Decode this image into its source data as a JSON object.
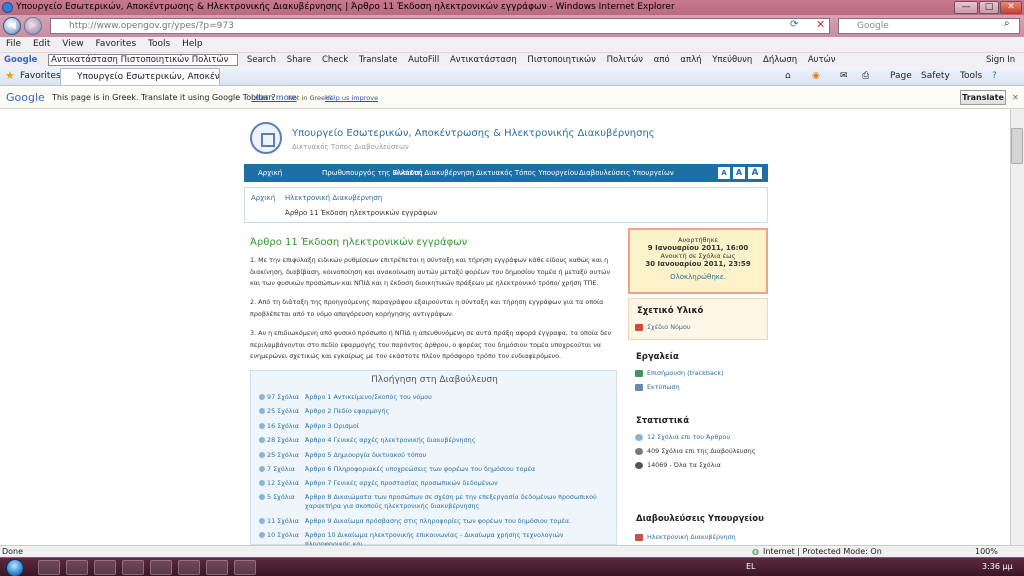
{
  "window": {
    "title": "Υπουργείο Εσωτερικών, Αποκέντρωσης & Ηλεκτρονικής Διακυβέρνησης | Άρθρο 11 Έκδοση ηλεκτρονικών εγγράφων - Windows Internet Explorer",
    "minimize": "—",
    "maximize": "□",
    "close": "✕"
  },
  "address": {
    "url": "http://www.opengov.gr/ypes/?p=973",
    "search_placeholder": "Google"
  },
  "menu": [
    "File",
    "Edit",
    "View",
    "Favorites",
    "Tools",
    "Help"
  ],
  "google_toolbar": {
    "logo": "Google",
    "query": "Αντικατάσταση Πιστοποιητικών Πολιτών",
    "items": [
      "Search",
      "Share",
      "Check",
      "Translate",
      "AutoFill",
      "Αντικατάσταση",
      "Πιστοποιητικών",
      "Πολιτών",
      "από",
      "απλή",
      "Υπεύθυνη",
      "Δήλωση",
      "Αυτών"
    ],
    "sign_in": "Sign In"
  },
  "favorites": {
    "label": "Favorites",
    "tab": "Υπουργείο Εσωτερικών, Αποκέντρω...",
    "page": "Page",
    "safety": "Safety",
    "tools": "Tools"
  },
  "translate_bar": {
    "logo": "Google",
    "message": "This page is in Greek.  Translate it using Google Toolbar?",
    "learn_more": "Learn more",
    "not_greek": "Not in Greek?",
    "help": "Help us improve",
    "button": "Translate",
    "close": "✕"
  },
  "site": {
    "title": "Υπουργείο Εσωτερικών, Αποκέντρωσης & Ηλεκτρονικής Διακυβέρνησης",
    "subtitle": "Δικτυακός Τόπος Διαβουλεύσεων",
    "nav": [
      "Αρχική",
      "Πρωθυπουργός της Ελλάδας",
      "Ανοικτή Διακυβέρνηση",
      "Δικτυακός Τόπος Υπουργείου",
      "Διαβουλεύσεις Υπουργείων"
    ],
    "font_sizes": [
      "A",
      "A",
      "A"
    ]
  },
  "breadcrumb": {
    "home": "Αρχική",
    "section": "Ηλεκτρονική Διακυβέρνηση",
    "current": "Άρθρο 11 Έκδοση ηλεκτρονικών εγγράφων"
  },
  "article": {
    "title": "Άρθρο 11 Έκδοση ηλεκτρονικών εγγράφων",
    "p1": "1.        Με την επιφύλαξη ειδικών ρυθμίσεων επιτρέπεται η σύνταξη και τήρηση εγγράφων κάθε είδους καθώς και η διακίνηση, διαβίβαση, κοινοποίηση  και ανακοίνωση  αυτών μεταξύ φορέων του δημοσίου τομέα  ή μεταξύ αυτών και των φυσικών προσώπων και ΝΠΙΔ και η έκδοση διοικητικών πράξεων με ηλεκτρονικό τρόπο/ χρήση ΤΠΕ.",
    "p2": "2.        Από τη διάταξη της προηγούμενης παραγράφου εξαιρούνται η σύνταξη και τήρηση εγγράφων για τα οποία προβλέπεται από το νόμο απαγόρευση κορήγησης αντιγράφων.",
    "p3": "3.        Αν η επιδιωκόμενη από φυσικό πρόσωπο ή ΝΠΙΔ η απευθυνόμενη σε αυτά πράξη αφορά έγγραφα, τα οποία δεν περιλαμβάνονται στο πεδίο εφαρμογής του παρόντος άρθρου, ο φορέας του δημόσιου τομέα  υποχρεούται να ενημερώνει σχετικώς και εγκαίρως με τον εκάστοτε πλέον πρόσφορο τρόπο τον ενδιαφερόμενο."
  },
  "navigation": {
    "title": "Πλοήγηση στη Διαβούλευση",
    "rows": [
      {
        "count": "97 Σχόλια",
        "title": "Άρθρο 1 Αντικείμενο/Σκοπός του νόμου"
      },
      {
        "count": "25 Σχόλια",
        "title": "Άρθρο 2 Πεδίο εφαρμογής"
      },
      {
        "count": "16 Σχόλια",
        "title": "Άρθρο 3 Ορισμοί"
      },
      {
        "count": "28 Σχόλια",
        "title": "Άρθρο 4 Γενικές αρχές ηλεκτρονικής διακυβέρνησης"
      },
      {
        "count": "25 Σχόλια",
        "title": "Άρθρο 5 Δημιουργία δικτυακού τόπου"
      },
      {
        "count": "7 Σχόλια",
        "title": "Άρθρο 6 Πληροφοριακές υποχρεώσεις των φορέων του δημόσιου τομέα"
      },
      {
        "count": "12 Σχόλια",
        "title": "Άρθρο 7 Γενικές αρχές προστασίας προσωπικών δεδομένων"
      },
      {
        "count": "5 Σχόλια",
        "title": "Άρθρο 8 Δικαιώματα των προσώπων σε σχέση με την επεξεργασία δεδομένων προσωπικού χαρακτήρα για σκοπούς ηλεκτρονικής διακυβέρνησης"
      },
      {
        "count": "11 Σχόλια",
        "title": "Άρθρο 9 Δικαίωμα πρόσβασης στις πληροφορίες των φορέων του δημόσιου τομέα."
      },
      {
        "count": "10 Σχόλια",
        "title": "Άρθρο 10 Δικαίωμα ηλεκτρονικής επικοινωνίας - Δικαίωμα χρήσης τεχνολογιών πληροφορικής και"
      }
    ]
  },
  "sidebar": {
    "posted_label": "Αναρτήθηκε",
    "posted_date": "9 Ιανουαρίου 2011, 16:00",
    "open_label": "Ανοικτή σε Σχόλια έως",
    "open_date": "30 Ιανουαρίου 2011, 23:59",
    "status": "Ολοκληρώθηκε.",
    "related_title": "Σχετικό Υλικό",
    "related_link": "Σχέδιο Νόμου",
    "tools_title": "Εργαλεία",
    "trackback": "Επισήμανση (trackback)",
    "print": "Εκτύπωση",
    "stats_title": "Στατιστικά",
    "stat1": "12 Σχόλια επι του Άρθρου",
    "stat2": "409 Σχόλια επι της Διαβούλευσης",
    "stat3": "14069 - Όλα τα Σχόλια",
    "ministries_title": "Διαβουλεύσεις Υπουργείου",
    "ministries_link": "Ηλεκτρονική Διακυβέρνηση"
  },
  "status": {
    "left": "Done",
    "zone": "Internet | Protected Mode: On",
    "zoom": "100%"
  },
  "taskbar": {
    "lang": "EL",
    "time": "3:36 μμ"
  }
}
